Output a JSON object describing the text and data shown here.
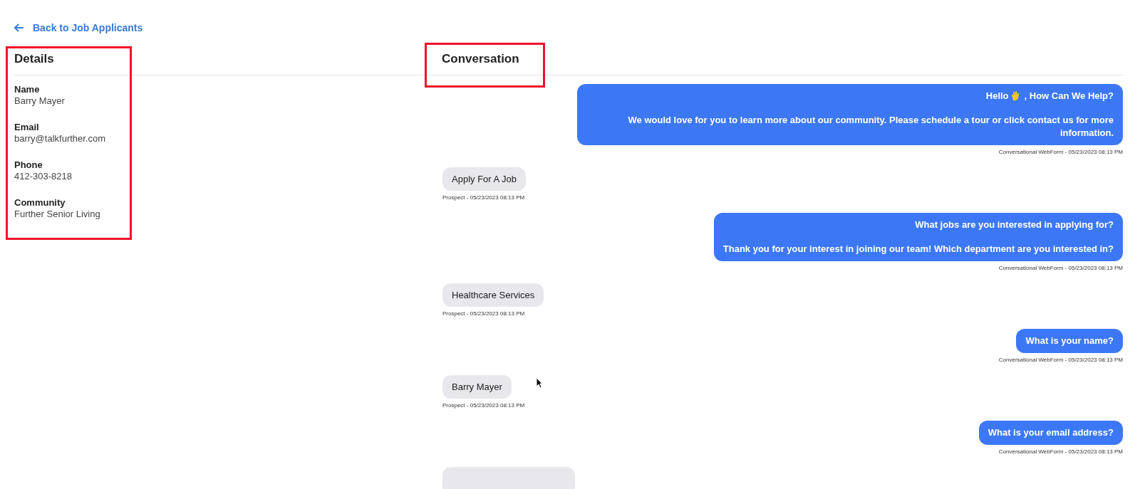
{
  "back_link": "Back to Job Applicants",
  "details": {
    "title": "Details",
    "fields": [
      {
        "label": "Name",
        "value": "Barry Mayer"
      },
      {
        "label": "Email",
        "value": "barry@talkfurther.com"
      },
      {
        "label": "Phone",
        "value": "412-303-8218"
      },
      {
        "label": "Community",
        "value": "Further Senior Living"
      }
    ]
  },
  "conversation": {
    "title": "Conversation",
    "messages": [
      {
        "kind": "bot",
        "title_parts": [
          "Hello",
          ", How Can We Help?"
        ],
        "body": "We would love for you to learn more about our community. Please schedule a tour or click contact us for more information.",
        "meta": "Conversational WebForm - 05/23/2023 08:13 PM"
      },
      {
        "kind": "prospect",
        "body": "Apply For A Job",
        "meta": "Prospect - 05/23/2023 08:13 PM"
      },
      {
        "kind": "bot",
        "title_parts": [
          "What jobs are you interested in applying for?"
        ],
        "body": "Thank you for your interest in joining our team! Which department are you interested in?",
        "meta": "Conversational WebForm - 05/23/2023 08:13 PM"
      },
      {
        "kind": "prospect",
        "body": "Healthcare Services",
        "meta": "Prospect - 05/23/2023 08:13 PM"
      },
      {
        "kind": "bot",
        "body": "What is your name?",
        "meta": "Conversational WebForm - 05/23/2023 08:13 PM"
      },
      {
        "kind": "prospect",
        "body": "Barry Mayer",
        "meta": "Prospect - 05/23/2023 08:13 PM"
      },
      {
        "kind": "bot",
        "body": "What is your email address?",
        "meta": "Conversational WebForm - 05/23/2023 08:13 PM"
      },
      {
        "kind": "prospect"
      }
    ]
  }
}
